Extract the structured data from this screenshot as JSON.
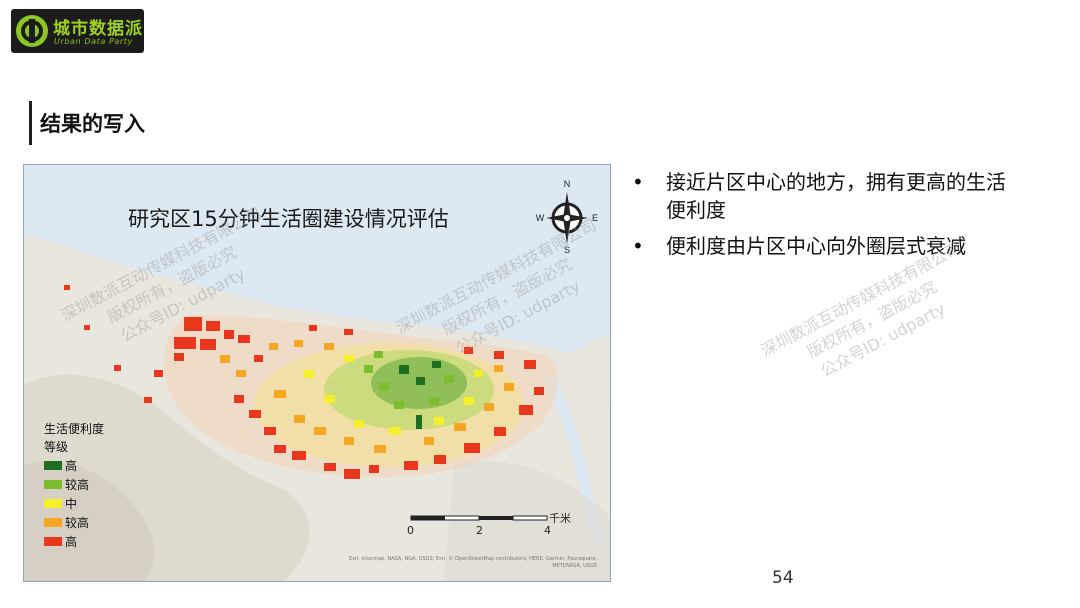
{
  "logo": {
    "name_cn": "城市数据派",
    "name_en": "Urban Data Party"
  },
  "slide": {
    "title": "结果的写入",
    "page_number": "54"
  },
  "map": {
    "title": "研究区15分钟生活圈建设情况评估",
    "compass": {
      "n": "N",
      "s": "S",
      "e": "E",
      "w": "W"
    },
    "legend": {
      "title": "生活便利度",
      "subtitle": "等级",
      "items": [
        {
          "label": "高",
          "color": "#1f6e1f"
        },
        {
          "label": "较高",
          "color": "#7dbb2f"
        },
        {
          "label": "中",
          "color": "#f3ef2a"
        },
        {
          "label": "较高",
          "color": "#f5a623"
        },
        {
          "label": "高",
          "color": "#e8371d"
        }
      ]
    },
    "scale": {
      "t0": "0",
      "t1": "2",
      "t2": "4",
      "unit": "千米"
    },
    "attribution": "Esri, Intermap, NASA, NGA, USGS; Esri, © OpenStreetMap contributors, HERE, Garmin, Foursquare, METI/NASA, USGS"
  },
  "bullets": [
    "接近片区中心的地方，拥有更高的生活便利度",
    "便利度由片区中心向外圈层式衰减"
  ],
  "watermark": {
    "line1": "深圳数派互动传媒科技有限公司",
    "line2": "版权所有，盗版必究",
    "line3": "公众号ID: udparty"
  }
}
